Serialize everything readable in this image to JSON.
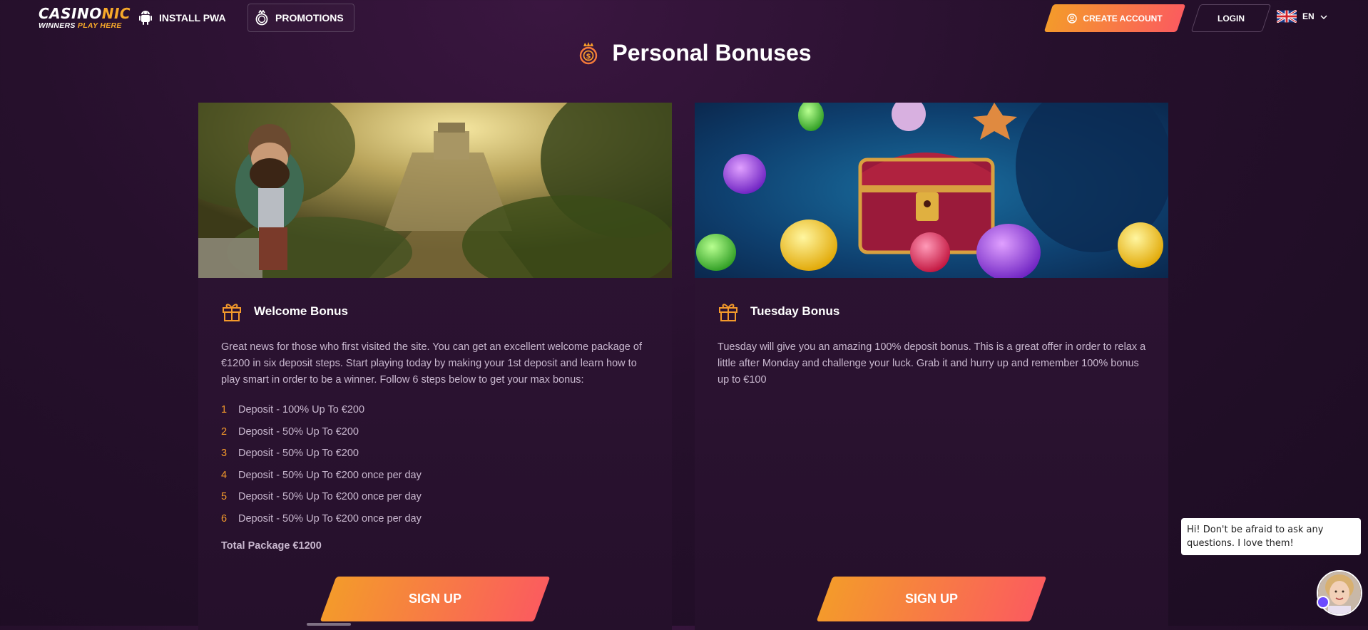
{
  "header": {
    "logo": {
      "main_a": "CASINO",
      "main_b": "NIC",
      "sub_a": "WINNERS ",
      "sub_b": "PLAY HERE"
    },
    "install_pwa": "INSTALL PWA",
    "promotions": "PROMOTIONS",
    "create_account": "CREATE ACCOUNT",
    "login": "LOGIN",
    "language": "EN"
  },
  "page": {
    "title": "Personal Bonuses"
  },
  "bonuses": [
    {
      "title": "Welcome Bonus",
      "description": "Great news for those who first visited the site. You can get an excellent welcome package of €1200 in six deposit steps. Start playing today by making your 1st deposit and learn how to play smart in order to be a winner. Follow 6 steps below to get your max bonus:",
      "steps": [
        {
          "num": "1",
          "text": "Deposit - 100% Up To €200"
        },
        {
          "num": "2",
          "text": "Deposit - 50% Up To €200"
        },
        {
          "num": "3",
          "text": "Deposit - 50% Up To €200"
        },
        {
          "num": "4",
          "text": "Deposit - 50% Up To €200 once per day"
        },
        {
          "num": "5",
          "text": "Deposit - 50% Up To €200 once per day"
        },
        {
          "num": "6",
          "text": "Deposit - 50% Up To €200 once per day"
        }
      ],
      "total": "Total Package €1200",
      "cta": "SIGN UP"
    },
    {
      "title": "Tuesday Bonus",
      "description": "Tuesday will give you an amazing 100% deposit bonus. This is a great offer in order to relax a little after Monday and challenge your luck. Grab it and hurry up and remember 100% bonus up to €100",
      "cta": "SIGN UP"
    }
  ],
  "chat": {
    "message": "Hi! Don't be afraid to ask any questions. I love them!"
  },
  "colors": {
    "accent": "#f49a2b",
    "accent_end": "#fb5c5e",
    "background": "#26102c",
    "card": "#2b1331"
  }
}
